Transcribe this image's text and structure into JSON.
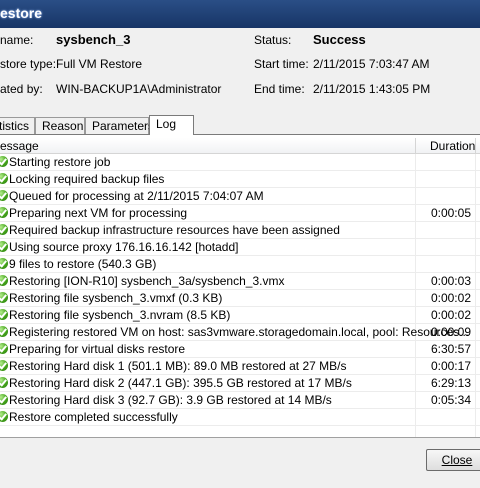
{
  "window": {
    "title": "estore"
  },
  "info": {
    "name_label": "name:",
    "name_value": "sysbench_3",
    "restore_type_label": "store type:",
    "restore_type_value": "Full VM Restore",
    "initiated_by_label": "ated by:",
    "initiated_by_value": "WIN-BACKUP1A\\Administrator",
    "status_label": "Status:",
    "status_value": "Success",
    "start_time_label": "Start time:",
    "start_time_value": "2/11/2015 7:03:47 AM",
    "end_time_label": "End time:",
    "end_time_value": "2/11/2015 1:43:05 PM"
  },
  "tabs": [
    {
      "label": "tistics",
      "active": false
    },
    {
      "label": "Reason",
      "active": false
    },
    {
      "label": "Parameters",
      "active": false
    },
    {
      "label": "Log",
      "active": true
    }
  ],
  "log": {
    "columns": {
      "message": "essage",
      "duration": "Duration"
    },
    "status_color": "#43a31a",
    "rows": [
      {
        "message": "Starting restore job",
        "duration": ""
      },
      {
        "message": "Locking required backup files",
        "duration": ""
      },
      {
        "message": "Queued for processing at 2/11/2015 7:04:07 AM",
        "duration": ""
      },
      {
        "message": "Preparing next VM for processing",
        "duration": "0:00:05"
      },
      {
        "message": "Required backup infrastructure resources have been assigned",
        "duration": ""
      },
      {
        "message": "Using source proxy 176.16.16.142 [hotadd]",
        "duration": ""
      },
      {
        "message": "9 files to restore (540.3 GB)",
        "duration": ""
      },
      {
        "message": "Restoring [ION-R10] sysbench_3a/sysbench_3.vmx",
        "duration": "0:00:03"
      },
      {
        "message": "Restoring file sysbench_3.vmxf (0.3 KB)",
        "duration": "0:00:02"
      },
      {
        "message": "Restoring file sysbench_3.nvram (8.5 KB)",
        "duration": "0:00:02"
      },
      {
        "message": "Registering restored VM on host: sas3vmware.storagedomain.local, pool: Resources...",
        "duration": "0:00:09"
      },
      {
        "message": "Preparing for virtual disks restore",
        "duration": "6:30:57"
      },
      {
        "message": "Restoring Hard disk 1 (501.1 MB): 89.0 MB restored at 27 MB/s",
        "duration": "0:00:17"
      },
      {
        "message": "Restoring Hard disk 2 (447.1 GB): 395.5 GB restored at 17 MB/s",
        "duration": "6:29:13"
      },
      {
        "message": "Restoring Hard disk 3 (92.7 GB): 3.9 GB restored at 14 MB/s",
        "duration": "0:05:34"
      },
      {
        "message": "Restore completed successfully",
        "duration": ""
      }
    ]
  },
  "buttons": {
    "close": "Close"
  }
}
